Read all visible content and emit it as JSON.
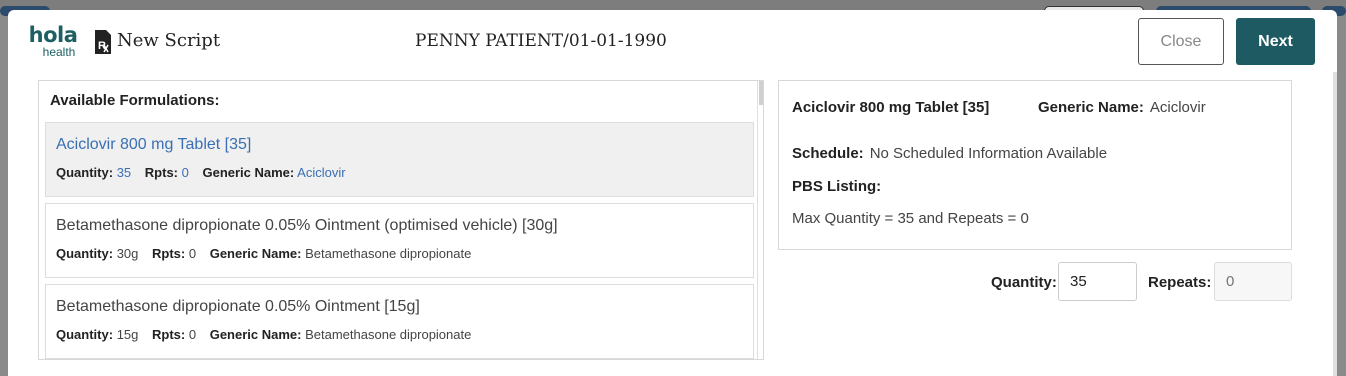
{
  "header": {
    "logo_top": "hola",
    "logo_bottom": "health",
    "title": "New Script",
    "patient": "PENNY PATIENT/01-01-1990",
    "close_label": "Close",
    "next_label": "Next"
  },
  "formulations": {
    "title": "Available Formulations:",
    "quantity_label": "Quantity:",
    "repeats_label": "Rpts:",
    "generic_label": "Generic Name:",
    "items": [
      {
        "name": "Aciclovir 800 mg Tablet [35]",
        "quantity": "35",
        "repeats": "0",
        "generic": "Aciclovir",
        "selected": true
      },
      {
        "name": "Betamethasone dipropionate 0.05% Ointment (optimised vehicle) [30g]",
        "quantity": "30g",
        "repeats": "0",
        "generic": "Betamethasone dipropionate",
        "selected": false
      },
      {
        "name": "Betamethasone dipropionate 0.05% Ointment [15g]",
        "quantity": "15g",
        "repeats": "0",
        "generic": "Betamethasone dipropionate",
        "selected": false
      }
    ]
  },
  "detail": {
    "name": "Aciclovir 800 mg Tablet [35]",
    "generic_label": "Generic Name:",
    "generic_value": "Aciclovir",
    "schedule_label": "Schedule:",
    "schedule_value": "No Scheduled Information Available",
    "pbs_label": "PBS Listing:",
    "max_text": "Max Quantity = 35 and Repeats = 0"
  },
  "entry": {
    "quantity_label": "Quantity:",
    "quantity_value": "35",
    "repeats_label": "Repeats:",
    "repeats_placeholder": "0"
  },
  "colors": {
    "brand": "#1d5a61",
    "link": "#3a6fb4"
  }
}
